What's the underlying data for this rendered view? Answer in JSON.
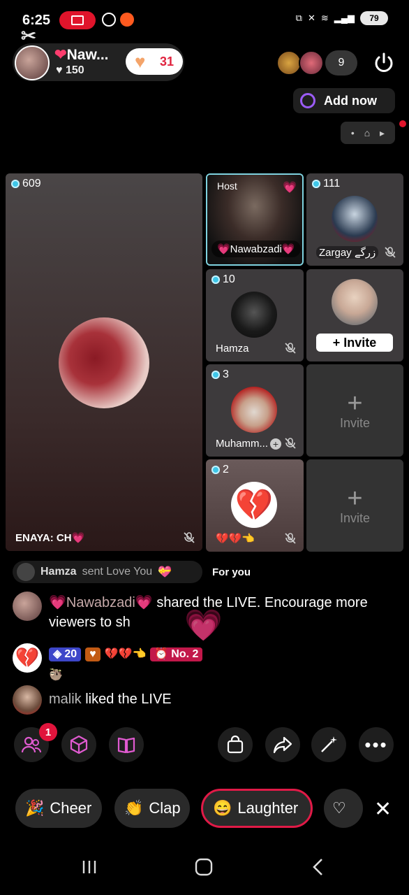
{
  "status_bar": {
    "time": "6:25",
    "battery": "79"
  },
  "host": {
    "name": "Naw...",
    "likes": "150",
    "follow_count": "31"
  },
  "viewers": {
    "count": "9"
  },
  "add_now": {
    "label": "Add now"
  },
  "main_guest": {
    "score": "609",
    "name": "ENAYA: CH💗"
  },
  "host_tile": {
    "tag": "Host",
    "name": "💗Nawabzadi💗"
  },
  "guests": [
    {
      "score": "111",
      "name": "Zargay زرگے"
    },
    {
      "score": "10",
      "name": "Hamza"
    },
    {
      "score": "3",
      "name": "Muhamm..."
    },
    {
      "score": "2",
      "name": "💔💔👈"
    }
  ],
  "invite": {
    "label": "Invite",
    "plus_label": "+ Invite"
  },
  "gift_strip": {
    "user": "Hamza",
    "text": "sent Love You"
  },
  "for_you": "For you",
  "comments": [
    {
      "user": "💗Nawabzadi💗",
      "text": "shared the LIVE. Encourage more viewers to sh"
    },
    {
      "level": "20",
      "badge2": "💔💔👈",
      "no": "No. 2",
      "extra": "🦥"
    },
    {
      "user": "malik",
      "text": "liked the LIVE"
    }
  ],
  "notif_count": "1",
  "reactions": [
    {
      "label": "Cheer"
    },
    {
      "label": "Clap"
    },
    {
      "label": "Laughter"
    }
  ],
  "colors": {
    "accent": "#e01a47",
    "gem": "#3ec7e9",
    "host_border": "#7fd3e0"
  }
}
